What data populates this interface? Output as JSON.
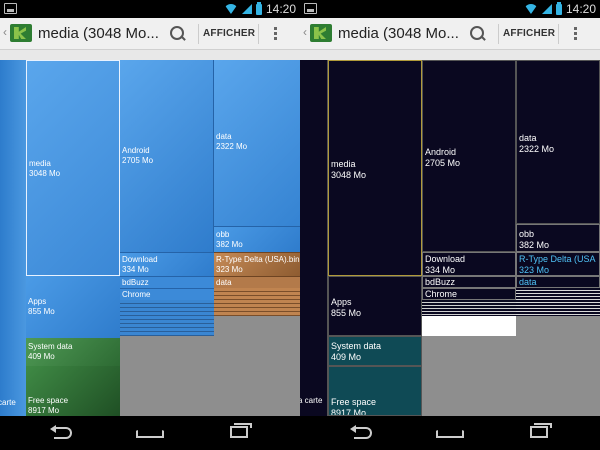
{
  "status": {
    "time": "14:20"
  },
  "actionbar": {
    "title": "media (3048 Mo...",
    "afficher_label": "AFFICHER"
  },
  "icons": {
    "search": "search-icon",
    "overflow": "overflow-menu-icon",
    "app": "diskusage-app-icon",
    "back": "back-icon",
    "home": "home-icon",
    "recent": "recent-apps-icon"
  },
  "colors": {
    "left_blue": "#3d8ede",
    "left_blue_light": "#5aa6ec",
    "left_green": "#2f6b3a",
    "left_orange": "#b37a4a",
    "left_gray": "#8e8e8e",
    "right_dark": "#0a0820",
    "right_teal": "#0f4a55",
    "right_gold": "#b09a3a",
    "right_cyan_text": "#4fc3f7"
  },
  "treemap_left": {
    "edge_label": "carte",
    "media": {
      "name": "media",
      "size": "3048 Mo"
    },
    "apps": {
      "name": "Apps",
      "size": "855 Mo"
    },
    "system": {
      "name": "System data",
      "size": "409 Mo"
    },
    "free": {
      "name": "Free space",
      "size": "8917 Mo"
    },
    "android": {
      "name": "Android",
      "size": "2705 Mo"
    },
    "download": {
      "name": "Download",
      "size": "334 Mo"
    },
    "bdbuzz": {
      "name": "bdBuzz"
    },
    "chrome": {
      "name": "Chrome"
    },
    "data": {
      "name": "data",
      "size": "2322 Mo"
    },
    "obb": {
      "name": "obb",
      "size": "382 Mo"
    },
    "rtype": {
      "name": "R-Type Delta (USA).bin",
      "size": "323 Mo"
    },
    "data2": {
      "name": "data"
    }
  },
  "treemap_right": {
    "edge_label": "a carte",
    "media": {
      "name": "media",
      "size": "3048 Mo"
    },
    "apps": {
      "name": "Apps",
      "size": "855 Mo"
    },
    "system": {
      "name": "System data",
      "size": "409 Mo"
    },
    "free": {
      "name": "Free space",
      "size": "8917 Mo"
    },
    "android": {
      "name": "Android",
      "size": "2705 Mo"
    },
    "download": {
      "name": "Download",
      "size": "334 Mo"
    },
    "bdbuzz": {
      "name": "bdBuzz"
    },
    "chrome": {
      "name": "Chrome"
    },
    "data": {
      "name": "data",
      "size": "2322 Mo"
    },
    "obb": {
      "name": "obb",
      "size": "382 Mo"
    },
    "rtype": {
      "name": "R-Type Delta (USA",
      "size": "323 Mo"
    },
    "data2": {
      "name": "data"
    }
  }
}
